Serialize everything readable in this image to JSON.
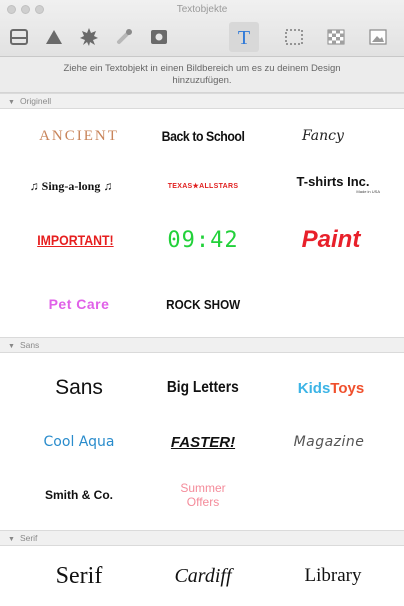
{
  "window": {
    "title": "Textobjekte"
  },
  "toolbar": {
    "tools": [
      {
        "icon": "layout-icon"
      },
      {
        "icon": "shapes-icon"
      },
      {
        "icon": "badge-icon"
      },
      {
        "icon": "brush-icon"
      },
      {
        "icon": "photo-frame-icon"
      },
      {
        "icon": "text-icon",
        "active": true
      },
      {
        "icon": "selection-icon"
      },
      {
        "icon": "pattern-icon"
      },
      {
        "icon": "image-icon"
      }
    ]
  },
  "hint": {
    "line1": "Ziehe ein Textobjekt in einen Bildbereich um es zu deinem Design",
    "line2": "hinzuzufügen."
  },
  "sections": {
    "originell": {
      "label": "Originell"
    },
    "sans": {
      "label": "Sans"
    },
    "serif": {
      "label": "Serif"
    }
  },
  "items": {
    "ancient": "ANCIENT",
    "back_to_school": "Back to School",
    "fancy": "Fancy",
    "sing_a_long": "♫ Sing-a-long ♫",
    "texas_allstars": "TEXAS★ALLSTARS",
    "tshirts": "T-shirts Inc.",
    "tshirts_sub": "Made in USA",
    "important": "IMPORTANT!",
    "clock": "09:42",
    "paint": "Paint",
    "pet_care": "Pet Care",
    "rock_show": "ROCK SHOW",
    "sans": "Sans",
    "big_letters": "Big Letters",
    "kids": "Kids",
    "toys": "Toys",
    "cool_aqua": "Cool Aqua",
    "faster": "FASTER!",
    "magazine": "Magazine",
    "smith": "Smith & Co.",
    "summer": "Summer",
    "offers": "Offers",
    "serif": "Serif",
    "cardiff": "Cardiff",
    "library": "Library"
  },
  "colors": {
    "ancient": "#c8845a",
    "texas": "#e01f1f",
    "important": "#e61e1e",
    "clock": "#22d13a",
    "paint": "#e8202a",
    "pet_care": "#e060e8",
    "kids": "#3cb4e6",
    "toys": "#f0502d",
    "cool_aqua": "#2a8ccc",
    "summer": "#f48b9a"
  }
}
